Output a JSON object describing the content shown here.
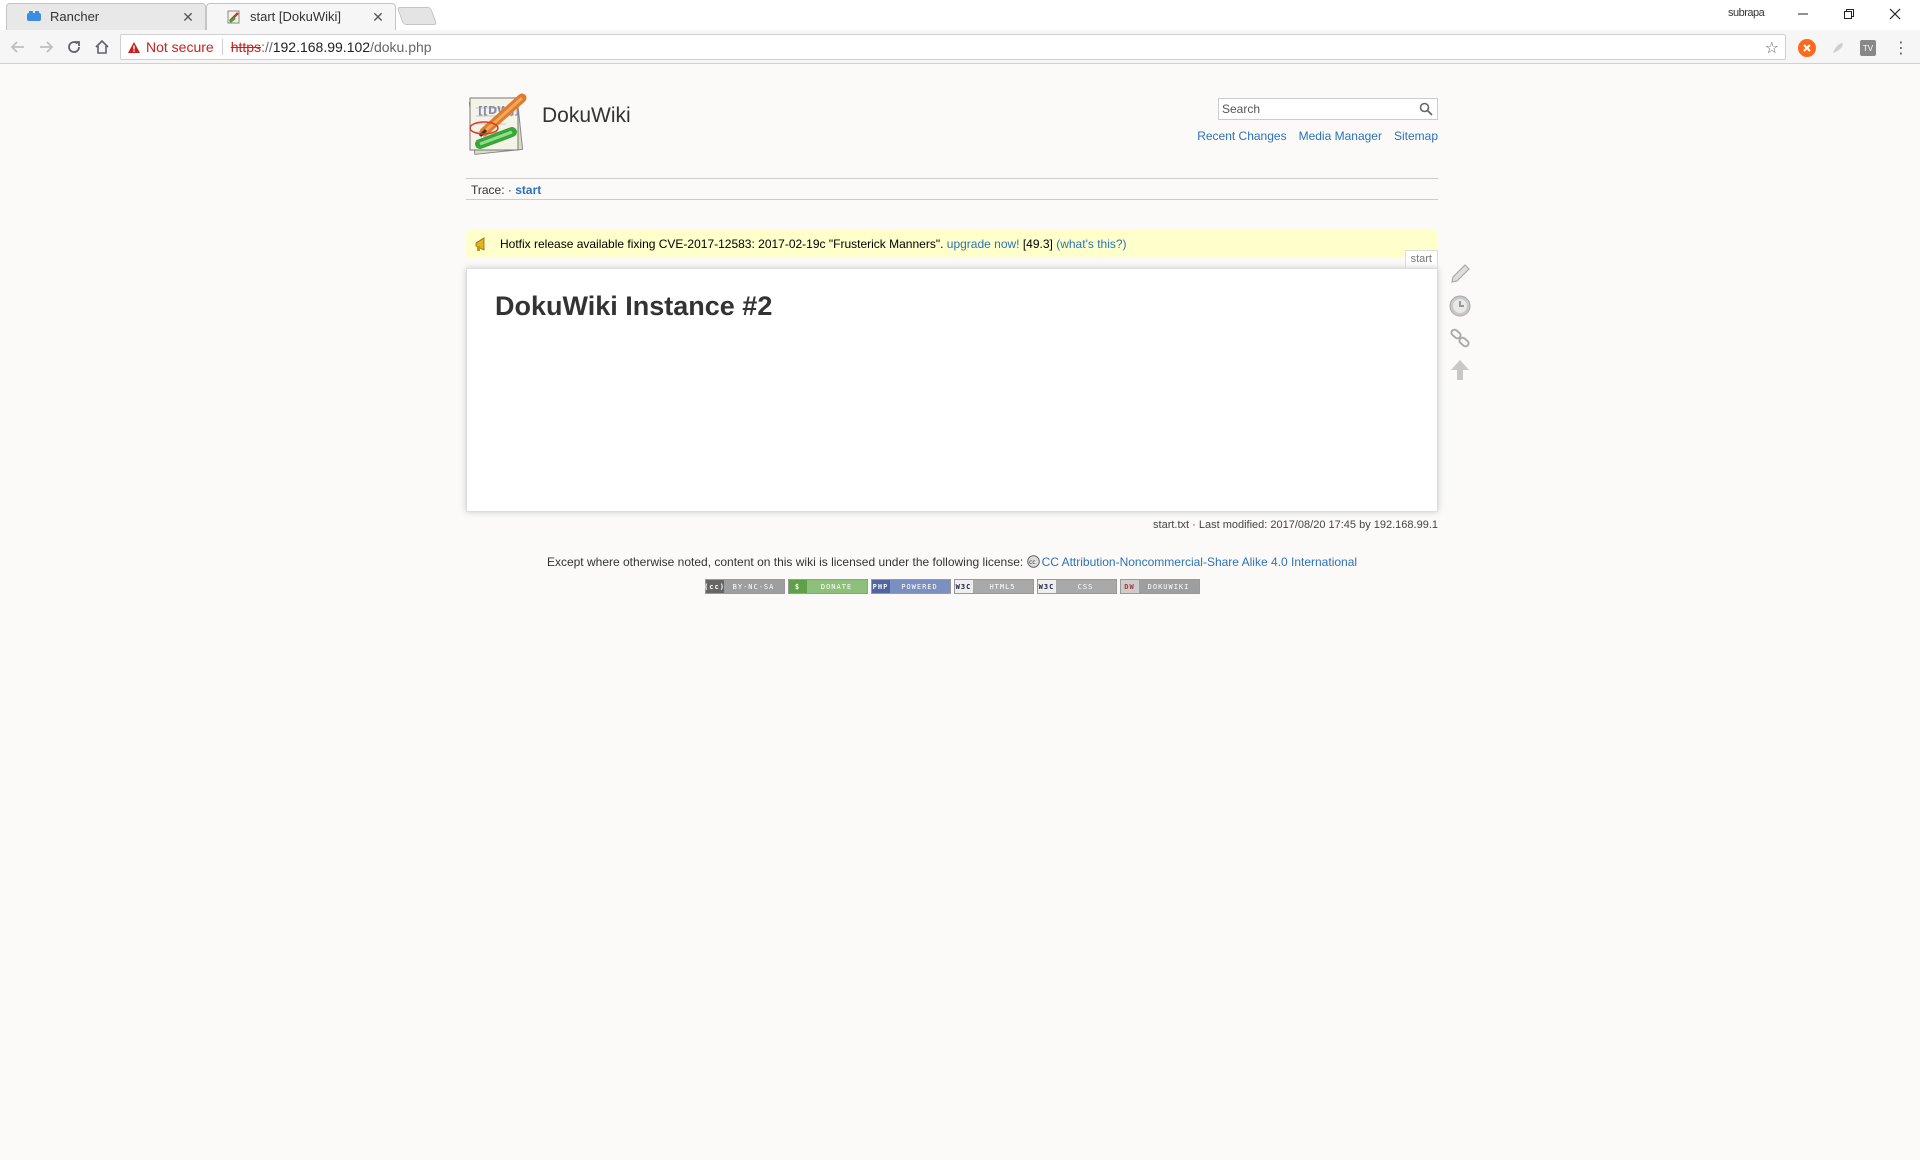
{
  "browser": {
    "tabs": [
      {
        "title": "Rancher",
        "favicon": "rancher-cow-icon",
        "active": false
      },
      {
        "title": "start [DokuWiki]",
        "favicon": "dokuwiki-icon",
        "active": true
      }
    ],
    "profile_name": "subrapa",
    "address": {
      "security_label": "Not secure",
      "scheme": "https",
      "rest_of_scheme": "://",
      "host": "192.168.99.102",
      "path": "/doku.php"
    },
    "icons": {
      "back": "back-arrow-icon",
      "forward": "forward-arrow-icon",
      "reload": "reload-icon",
      "home": "home-icon",
      "bookmark": "star-icon",
      "menu": "kebab-menu-icon"
    }
  },
  "wiki": {
    "title": "DokuWiki",
    "search_placeholder": "Search",
    "tools": [
      "Recent Changes",
      "Media Manager",
      "Sitemap"
    ],
    "trace_label": "Trace:",
    "trace_sep": "·",
    "trace_link": "start",
    "message": {
      "text": "Hotfix release available fixing CVE-2017-12583: 2017-02-19c \"Frusterick Manners\".",
      "upgrade_link": "upgrade now!",
      "version": "[49.3]",
      "whats_this": "(what's this?)",
      "background": "#ffffcc"
    },
    "page_tab": "start",
    "heading": "DokuWiki Instance #2",
    "docinfo": "start.txt · Last modified: 2017/08/20 17:45 by 192.168.99.1",
    "license_prefix": "Except where otherwise noted, content on this wiki is licensed under the following license:",
    "license_link": "CC Attribution-Noncommercial-Share Alike 4.0 International",
    "badges": [
      {
        "left": "(cc)",
        "right": "BY-NC-SA",
        "color": "#9e9e9e"
      },
      {
        "left": "$",
        "right": "DONATE",
        "color": "#8dc07b"
      },
      {
        "left": "PHP",
        "right": "POWERED",
        "color": "#7b8fc0"
      },
      {
        "left": "W3C",
        "right": "HTML5",
        "color": "#a9a9a9"
      },
      {
        "left": "W3C",
        "right": "CSS",
        "color": "#a9a9a9"
      },
      {
        "left": "DW",
        "right": "DOKUWIKI",
        "color": "#9e9e9e"
      }
    ],
    "link_color": "#2b73b7"
  }
}
